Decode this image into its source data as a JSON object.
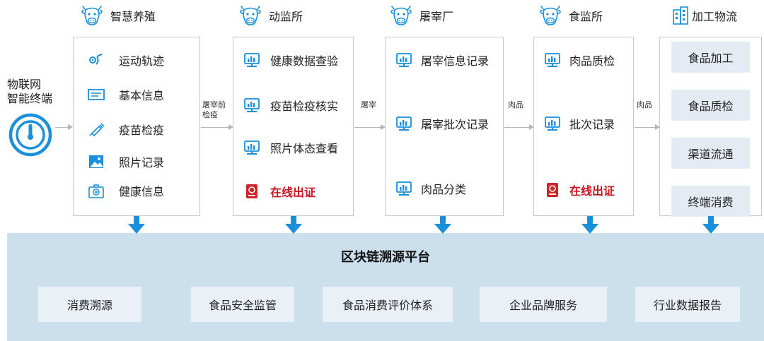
{
  "headers": {
    "farming": "智慧养殖",
    "vet": "动监所",
    "slaughter": "屠宰厂",
    "food_supervision": "食监所",
    "processing": "加工物流"
  },
  "iot": {
    "line1": "物联网",
    "line2": "智能终端"
  },
  "farming_items": [
    "运动轨迹",
    "基本信息",
    "疫苗检疫",
    "照片记录",
    "健康信息"
  ],
  "vet_items": [
    "健康数据查验",
    "疫苗检疫核实",
    "照片体态查看"
  ],
  "vet_cert": "在线出证",
  "slaughter_items": [
    "屠宰信息记录",
    "屠宰批次记录",
    "肉品分类"
  ],
  "food_items": [
    "肉品质检",
    "批次记录"
  ],
  "food_cert": "在线出证",
  "processing_items": [
    "食品加工",
    "食品质检",
    "渠道流通",
    "终端消费"
  ],
  "connectors": {
    "c1_line1": "屠宰前",
    "c1_line2": "检疫",
    "c2": "屠宰",
    "c3": "肉品",
    "c4": "肉品"
  },
  "platform": {
    "title": "区块链溯源平台",
    "services": [
      "消费溯源",
      "食品安全监管",
      "食品消费评价体系",
      "企业品牌服务",
      "行业数据报告"
    ]
  },
  "colors": {
    "accent_blue": "#1a8fdc",
    "cert_red": "#c8141e",
    "platform_bg": "#ccdfec",
    "process_box": "#e4ebf2"
  }
}
